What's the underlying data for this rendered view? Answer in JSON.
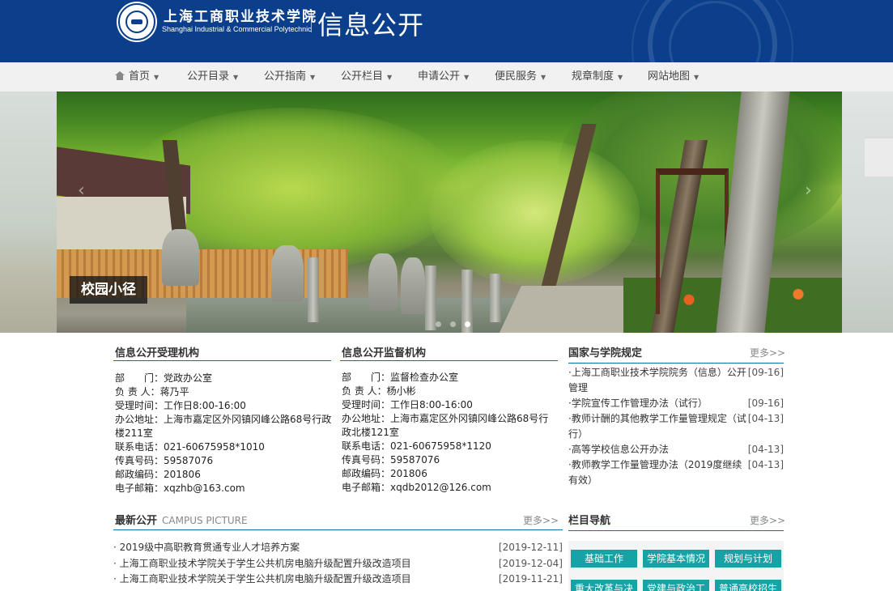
{
  "header": {
    "school_name_cn": "上海工商职业技术学院",
    "school_name_en": "Shanghai Industrial & Commercial Polytechnic",
    "site_title": "信息公开"
  },
  "nav": {
    "items": [
      {
        "label": "首页",
        "icon": "home-icon"
      },
      {
        "label": "公开目录"
      },
      {
        "label": "公开指南"
      },
      {
        "label": "公开栏目"
      },
      {
        "label": "申请公开"
      },
      {
        "label": "便民服务"
      },
      {
        "label": "规章制度"
      },
      {
        "label": "网站地图"
      }
    ],
    "caret": "▼"
  },
  "banner": {
    "caption": "校园小径",
    "slide_count": 3,
    "active_slide": 3
  },
  "acceptance": {
    "title": "信息公开受理机构",
    "rows": [
      {
        "k": "部　　门：",
        "v": "党政办公室"
      },
      {
        "k": "负 责 人：",
        "v": "蒋乃平"
      },
      {
        "k": "受理时间：",
        "v": "工作日8:00-16:00"
      },
      {
        "k": "办公地址：",
        "v": "上海市嘉定区外冈镇冈峰公路68号行政楼211室"
      },
      {
        "k": "联系电话：",
        "v": "021-60675958*1010"
      },
      {
        "k": "传真号码：",
        "v": "59587076"
      },
      {
        "k": "邮政编码：",
        "v": "201806"
      },
      {
        "k": "电子邮箱：",
        "v": "xqzhb@163.com"
      }
    ]
  },
  "supervision": {
    "title": "信息公开监督机构",
    "rows": [
      {
        "k": "部　　门：",
        "v": "监督检查办公室"
      },
      {
        "k": "负 责 人：",
        "v": "杨小彬"
      },
      {
        "k": "受理时间：",
        "v": "工作日8:00-16:00"
      },
      {
        "k": "办公地址：",
        "v": "上海市嘉定区外冈镇冈峰公路68号行政北楼121室"
      },
      {
        "k": "联系电话：",
        "v": "021-60675958*1120"
      },
      {
        "k": "传真号码：",
        "v": "59587076"
      },
      {
        "k": "邮政编码：",
        "v": "201806"
      },
      {
        "k": "电子邮箱：",
        "v": "xqdb2012@126.com"
      }
    ]
  },
  "regulations": {
    "title": "国家与学院规定",
    "more": "更多>>",
    "items": [
      {
        "title": "·上海工商职业技术学院院务（信息）公开管理",
        "date": "[09-16]"
      },
      {
        "title": "·学院宣传工作管理办法（试行）",
        "date": "[09-16]"
      },
      {
        "title": "·教师计酬的其他教学工作量管理规定（试行）",
        "date": "[04-13]"
      },
      {
        "title": "·高等学校信息公开办法",
        "date": "[04-13]"
      },
      {
        "title": "·教师教学工作量管理办法（2019度继续有效）",
        "date": "[04-13]"
      }
    ]
  },
  "latest": {
    "title": "最新公开",
    "subtitle": "CAMPUS PICTURE",
    "more": "更多>>",
    "items": [
      {
        "title": "· 2019级中高职教育贯通专业人才培养方案",
        "date": "[2019-12-11]"
      },
      {
        "title": "· 上海工商职业技术学院关于学生公共机房电脑升级配置升级改造项目",
        "date": "[2019-12-04]"
      },
      {
        "title": "· 上海工商职业技术学院关于学生公共机房电脑升级配置升级改造项目",
        "date": "[2019-11-21]"
      }
    ]
  },
  "categories": {
    "title": "栏目导航",
    "more": "更多>>",
    "buttons": [
      "基础工作",
      "学院基本情况",
      "规划与计划",
      "重大改革与决",
      "党建与政治工",
      "普通高校招生"
    ]
  },
  "colors": {
    "header_blue": "#0b3f8c",
    "rule_blue": "#0b6fa8",
    "button_teal": "#17a2a6"
  }
}
